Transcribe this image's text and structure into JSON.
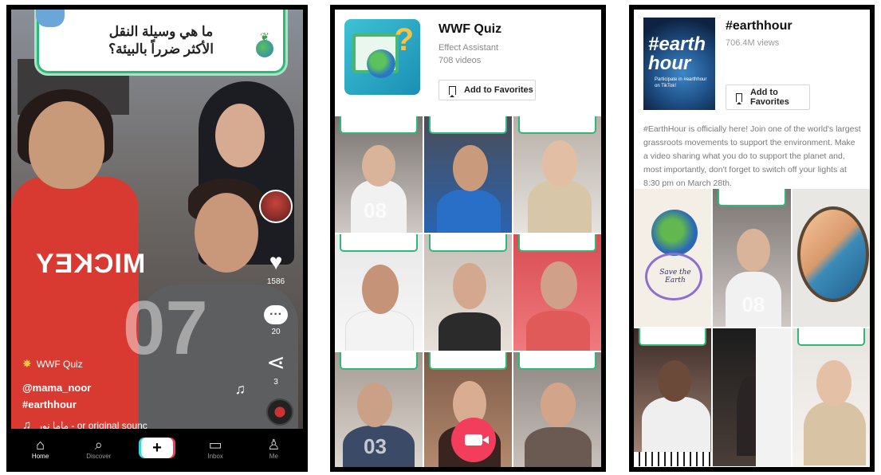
{
  "video": {
    "quiz_question": "ما هي وسيلة النقل\nالأكثر ضرراً بالبيئة؟",
    "overlay_number": "07",
    "shirt_text": "MICKEY",
    "likes": "1586",
    "comments": "20",
    "shares": "3",
    "effect_tag": "WWF Quiz",
    "username": "@mama_noor",
    "hashtag": "#earthhour",
    "sound": "ماما نور - or   original sounc",
    "nav": [
      {
        "label": "Home",
        "icon": "home-icon"
      },
      {
        "label": "Discover",
        "icon": "search-icon"
      },
      {
        "label": "",
        "icon": "plus-icon"
      },
      {
        "label": "Inbox",
        "icon": "inbox-icon"
      },
      {
        "label": "Me",
        "icon": "person-icon"
      }
    ]
  },
  "effect_page": {
    "title": "WWF Quiz",
    "subtitle": "Effect Assistant",
    "video_count": "708 videos",
    "favorite_label": "Add to Favorites",
    "tiles": [
      {
        "number": "08"
      },
      {
        "number": ""
      },
      {
        "number": ""
      },
      {
        "number": ""
      },
      {
        "number": ""
      },
      {
        "number": ""
      },
      {
        "number": "03"
      },
      {
        "number": ""
      },
      {
        "number": ""
      }
    ]
  },
  "hashtag_page": {
    "thumb_text_1": "#earth",
    "thumb_text_2": "hour",
    "thumb_caption": "Participate in #earthhour on TikTok!",
    "title": "#earthhour",
    "views": "706.4M views",
    "favorite_label": "Add to Favorites",
    "description": "#EarthHour is officially here! Join one of the world's largest grassroots movements to support the environment. Make a video sharing what you do to support the planet and, most importantly, don't forget to switch off your lights at 8:30 pm on March 28th.",
    "drawing_text": "Save the Earth",
    "tiles": [
      {
        "number": ""
      },
      {
        "number": "08"
      },
      {
        "number": ""
      },
      {
        "number": ""
      },
      {
        "number": ""
      },
      {
        "number": ""
      }
    ]
  },
  "colors": {
    "accent_green": "#30b77a",
    "record_red": "#f23d5c",
    "create_cyan": "#37d6e3"
  }
}
